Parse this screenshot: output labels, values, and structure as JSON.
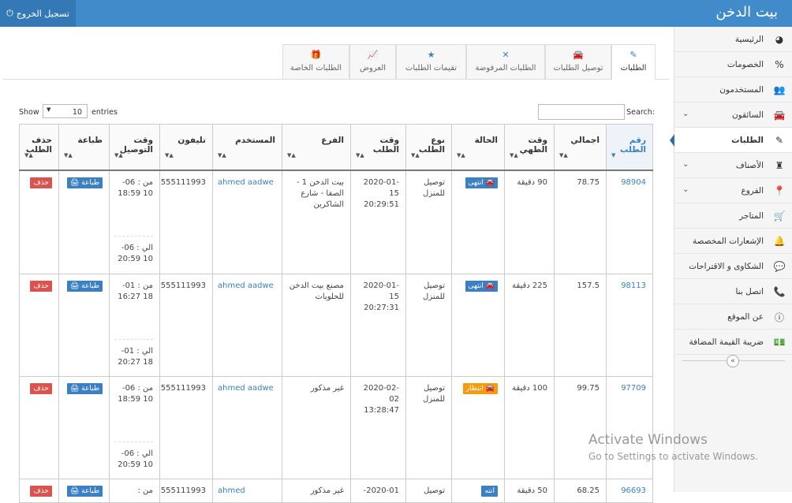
{
  "header": {
    "brand": "بيت الدخن",
    "logout": "تسجيل الخروج"
  },
  "sidebar": {
    "items": [
      {
        "label": "الرئيسية",
        "icon": "dashboard-icon"
      },
      {
        "label": "الخصومات",
        "icon": "percent-icon"
      },
      {
        "label": "المستخدمون",
        "icon": "users-icon"
      },
      {
        "label": "السائقون",
        "icon": "car-icon"
      },
      {
        "label": "الطلبات",
        "icon": "edit-icon"
      },
      {
        "label": "الأصناف",
        "icon": "castle-icon"
      },
      {
        "label": "الفروع",
        "icon": "map-marker-icon"
      },
      {
        "label": "المتاجر",
        "icon": "cart-icon"
      },
      {
        "label": "الإشعارات المخصصة",
        "icon": "bell-icon"
      },
      {
        "label": "الشكاوى و الاقتراحات",
        "icon": "comment-icon"
      },
      {
        "label": "اتصل بنا",
        "icon": "phone-icon"
      },
      {
        "label": "عن الموقع",
        "icon": "info-icon"
      },
      {
        "label": "ضريبة القيمة المضافة",
        "icon": "money-icon"
      }
    ]
  },
  "tabs": [
    {
      "label": "الطلبات",
      "icon": "edit-icon"
    },
    {
      "label": "توصيل الطلبات",
      "icon": "car-icon"
    },
    {
      "label": "الطلبات المرفوضة",
      "icon": "times-icon"
    },
    {
      "label": "تقيمات الطلبات",
      "icon": "star-icon"
    },
    {
      "label": "العروض",
      "icon": "chart-icon"
    },
    {
      "label": "الطلبات الخاصة",
      "icon": "gift-icon"
    }
  ],
  "table_controls": {
    "show": "Show",
    "entries_value": "10",
    "entries": "entries",
    "search": "Search:"
  },
  "columns": [
    "رقم الطلب",
    "اجمالي",
    "وقت الطهي",
    "الحالة",
    "نوع الطلب",
    "وقت الطلب",
    "الفرع",
    "المستخدم",
    "تليفون",
    "وقت التوصيل",
    "طباعة",
    "حذف الطلب"
  ],
  "rows": [
    {
      "id": "98904",
      "total": "78.75",
      "cook": "90 دقيقة",
      "status": "انتهى",
      "type": "توصيل للمنزل",
      "time": "2020-01-15 20:29:51",
      "branch": "بيت الدخن 1 - الصفا - شارع الشاكرين",
      "user": "ahmed aadwe",
      "phone": "555111993",
      "from": "من : 06-10 18:59",
      "to": "الي : 06-10 20:59"
    },
    {
      "id": "98113",
      "total": "157.5",
      "cook": "225 دقيقة",
      "status": "انتهى",
      "type": "توصيل للمنزل",
      "time": "2020-01-15 20:27:31",
      "branch": "مصنع بيت الدخن للحلويات",
      "user": "ahmed aadwe",
      "phone": "555111993",
      "from": "من : 01-18 16:27",
      "to": "الي : 01-18 20:27"
    },
    {
      "id": "97709",
      "total": "99.75",
      "cook": "100 دقيقة",
      "status": "انتظار",
      "type": "توصيل للمنزل",
      "time": "2020-02-02 13:28:47",
      "branch": "غير مذكور",
      "user": "ahmed aadwe",
      "phone": "555111993",
      "from": "من : 06-10 18:59",
      "to": "الي : 06-10 20:59"
    },
    {
      "id": "96693",
      "total": "68.25",
      "cook": "50 دقيقة",
      "status": "انته",
      "type": "توصيل",
      "time": "2020-01-",
      "branch": "غير مذكور",
      "user": "ahmed",
      "phone": "555111993",
      "from": "من :",
      "to": ""
    }
  ],
  "labels": {
    "print": "طباعة",
    "delete": "حذف"
  },
  "watermark": {
    "line1": "Activate Windows",
    "line2": "Go to Settings to activate Windows."
  }
}
